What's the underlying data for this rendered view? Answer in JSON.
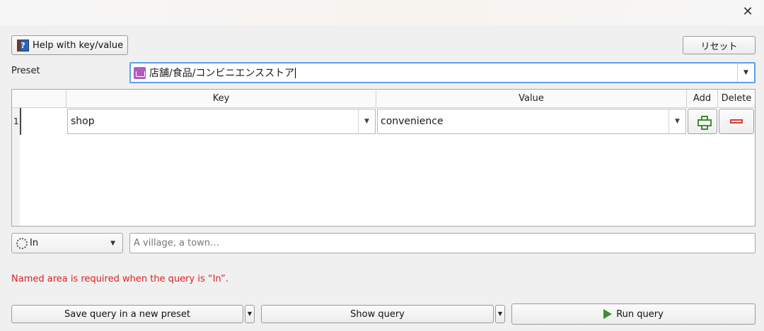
{
  "window": {
    "close_symbol": "✕"
  },
  "toolbar": {
    "help_label": "Help with key/value",
    "help_icon": "help-book-icon",
    "reset_label": "リセット"
  },
  "preset": {
    "label": "Preset",
    "value": "店舗/食品/コンビニエンスストア",
    "icon": "basket-icon"
  },
  "table": {
    "headers": [
      "",
      "Key",
      "Value",
      "Add",
      "Delete"
    ],
    "rows": [
      {
        "number": "1",
        "key": "shop",
        "value": "convenience"
      }
    ]
  },
  "area": {
    "mode": "In",
    "placeholder": "A village, a town…"
  },
  "error": "Named area is required when the query is “In”.",
  "buttons": {
    "save_label": "Save query in a new preset",
    "show_label": "Show query",
    "run_label": "Run query"
  },
  "colors": {
    "accent_border": "#5ea0e6",
    "error": "#e02020",
    "add_green": "#3a8f2e",
    "delete_red": "#d63a3a"
  }
}
